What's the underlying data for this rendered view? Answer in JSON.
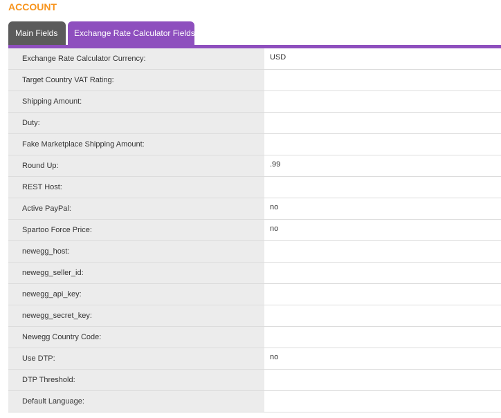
{
  "section": {
    "title": "ACCOUNT"
  },
  "tabs": [
    {
      "label": "Main Fields",
      "active": false
    },
    {
      "label": "Exchange Rate Calculator Fields",
      "active": true
    }
  ],
  "colors": {
    "accent_orange": "#f7941d",
    "tab_active": "#8e4fbe",
    "tab_inactive": "#5b5b5b",
    "label_bg": "#ececec"
  },
  "fields": [
    {
      "label": "Exchange Rate Calculator Currency:",
      "value": "USD"
    },
    {
      "label": "Target Country VAT Rating:",
      "value": ""
    },
    {
      "label": "Shipping Amount:",
      "value": ""
    },
    {
      "label": "Duty:",
      "value": ""
    },
    {
      "label": "Fake Marketplace Shipping Amount:",
      "value": ""
    },
    {
      "label": "Round Up:",
      "value": ".99"
    },
    {
      "label": "REST Host:",
      "value": ""
    },
    {
      "label": "Active PayPal:",
      "value": "no"
    },
    {
      "label": "Spartoo Force Price:",
      "value": "no"
    },
    {
      "label": "newegg_host:",
      "value": ""
    },
    {
      "label": "newegg_seller_id:",
      "value": ""
    },
    {
      "label": "newegg_api_key:",
      "value": ""
    },
    {
      "label": "newegg_secret_key:",
      "value": ""
    },
    {
      "label": "Newegg Country Code:",
      "value": ""
    },
    {
      "label": "Use DTP:",
      "value": "no"
    },
    {
      "label": "DTP Threshold:",
      "value": ""
    },
    {
      "label": "Default Language:",
      "value": ""
    }
  ]
}
